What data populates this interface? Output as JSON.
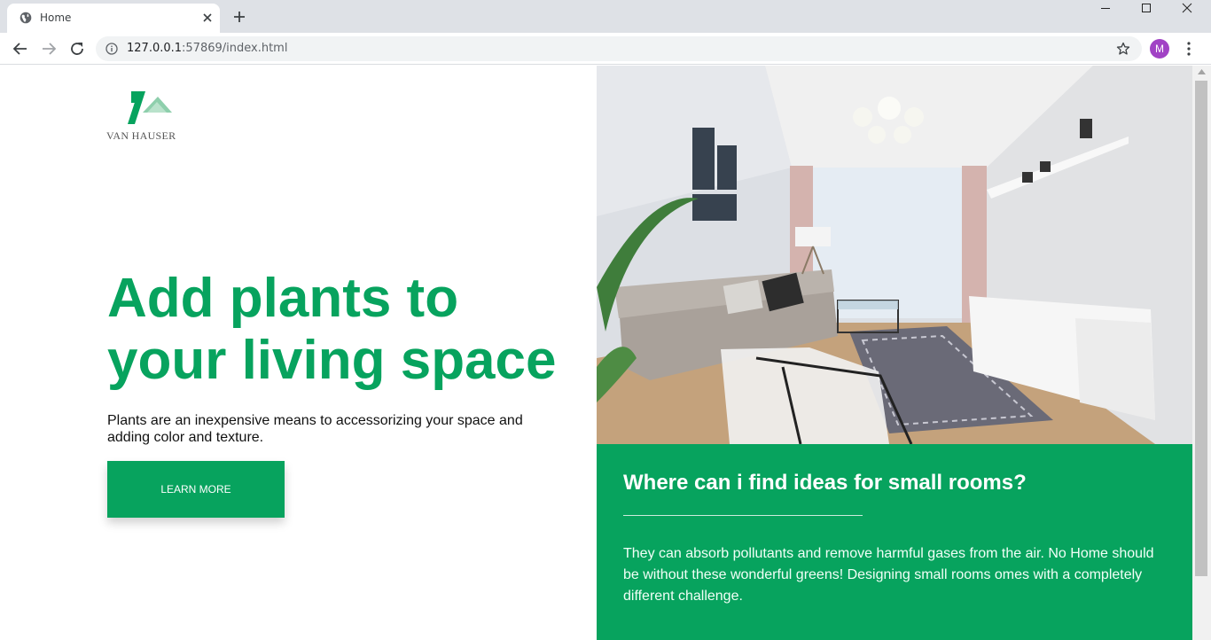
{
  "browser": {
    "tab_title": "Home",
    "url_host": "127.0.0.1",
    "url_path": ":57869/index.html",
    "profile_initial": "M",
    "profile_color": "#a142c5"
  },
  "page": {
    "brand_name": "VAN HAUSER",
    "headline": "Add plants to your living space",
    "subtext": "Plants are an inexpensive means to accessorizing your space and adding color and texture.",
    "cta_label": "LEARN MORE",
    "panel_title": "Where can i find ideas for small rooms?",
    "panel_body": "They can absorb pollutants and remove harmful gases from the air. No Home should be without these wonderful greens! Designing small rooms omes with a completely different challenge."
  },
  "colors": {
    "accent": "#07a35e"
  }
}
